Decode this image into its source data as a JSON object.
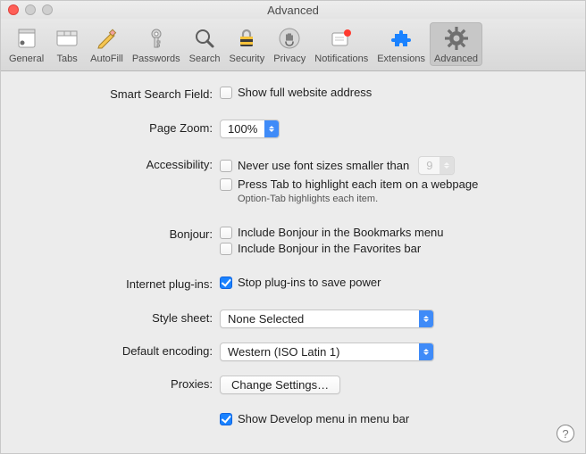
{
  "window": {
    "title": "Advanced"
  },
  "toolbar": {
    "items": [
      {
        "label": "General"
      },
      {
        "label": "Tabs"
      },
      {
        "label": "AutoFill"
      },
      {
        "label": "Passwords"
      },
      {
        "label": "Search"
      },
      {
        "label": "Security"
      },
      {
        "label": "Privacy"
      },
      {
        "label": "Notifications"
      },
      {
        "label": "Extensions"
      },
      {
        "label": "Advanced"
      }
    ]
  },
  "sections": {
    "smart_search": {
      "label": "Smart Search Field:",
      "show_full_url": "Show full website address"
    },
    "page_zoom": {
      "label": "Page Zoom:",
      "value": "100%"
    },
    "accessibility": {
      "label": "Accessibility:",
      "never_smaller": "Never use font sizes smaller than",
      "font_size": "9",
      "press_tab": "Press Tab to highlight each item on a webpage",
      "option_note": "Option-Tab highlights each item."
    },
    "bonjour": {
      "label": "Bonjour:",
      "bookmarks": "Include Bonjour in the Bookmarks menu",
      "favorites": "Include Bonjour in the Favorites bar"
    },
    "plugins": {
      "label": "Internet plug-ins:",
      "stop": "Stop plug-ins to save power"
    },
    "style_sheet": {
      "label": "Style sheet:",
      "value": "None Selected"
    },
    "encoding": {
      "label": "Default encoding:",
      "value": "Western (ISO Latin 1)"
    },
    "proxies": {
      "label": "Proxies:",
      "button": "Change Settings…"
    },
    "develop": {
      "label": "Show Develop menu in menu bar"
    }
  },
  "help": "?"
}
